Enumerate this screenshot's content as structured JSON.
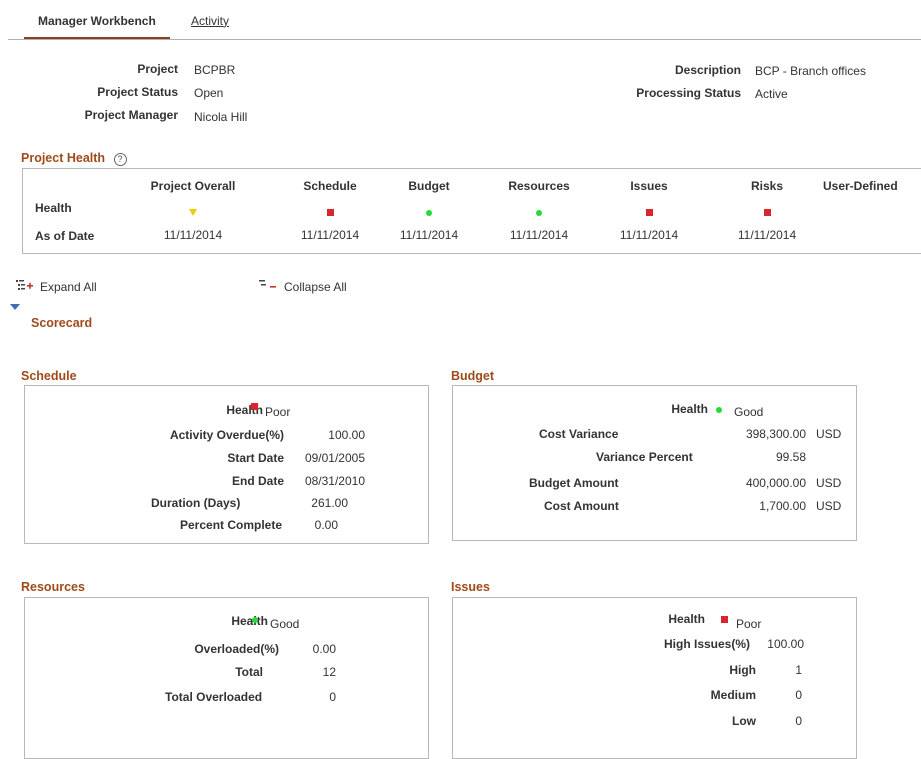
{
  "tabs": [
    {
      "label": "Manager Workbench",
      "active": true
    },
    {
      "label": "Activity",
      "active": false
    }
  ],
  "header": {
    "project_label": "Project",
    "project_value": "BCPBR",
    "status_label": "Project Status",
    "status_value": "Open",
    "manager_label": "Project Manager",
    "manager_value": "Nicola Hill",
    "description_label": "Description",
    "description_value": "BCP - Branch offices",
    "processing_label": "Processing Status",
    "processing_value": "Active"
  },
  "project_health": {
    "title": "Project Health",
    "help_icon": "?",
    "row_health": "Health",
    "row_asof": "As of Date",
    "columns": [
      "Project Overall",
      "Schedule",
      "Budget",
      "Resources",
      "Issues",
      "Risks",
      "User-Defined"
    ],
    "indicators": [
      "triangle-yellow",
      "square-red",
      "circle-green",
      "circle-green",
      "square-red",
      "square-red",
      ""
    ],
    "dates": [
      "11/11/2014",
      "11/11/2014",
      "11/11/2014",
      "11/11/2014",
      "11/11/2014",
      "11/11/2014",
      ""
    ]
  },
  "toolbar": {
    "expand_label": "Expand All",
    "collapse_label": "Collapse All",
    "scorecard_label": "Scorecard"
  },
  "schedule": {
    "title": "Schedule",
    "health_label": "Health",
    "health_value": "Poor",
    "overdue_label": "Activity Overdue(%)",
    "overdue_value": "100.00",
    "start_label": "Start Date",
    "start_value": "09/01/2005",
    "end_label": "End Date",
    "end_value": "08/31/2010",
    "duration_label": "Duration (Days)",
    "duration_value": "261.00",
    "complete_label": "Percent Complete",
    "complete_value": "0.00"
  },
  "budget": {
    "title": "Budget",
    "health_label": "Health",
    "health_value": "Good",
    "cost_var_label": "Cost Variance",
    "cost_var_value": "398,300.00",
    "cost_var_cur": "USD",
    "var_pct_label": "Variance Percent",
    "var_pct_value": "99.58",
    "budget_amt_label": "Budget Amount",
    "budget_amt_value": "400,000.00",
    "budget_amt_cur": "USD",
    "cost_amt_label": "Cost Amount",
    "cost_amt_value": "1,700.00",
    "cost_amt_cur": "USD"
  },
  "resources": {
    "title": "Resources",
    "health_label": "Health",
    "health_value": "Good",
    "overloaded_pct_label": "Overloaded(%)",
    "overloaded_pct_value": "0.00",
    "total_label": "Total",
    "total_value": "12",
    "total_overloaded_label": "Total Overloaded",
    "total_overloaded_value": "0"
  },
  "issues": {
    "title": "Issues",
    "health_label": "Health",
    "health_value": "Poor",
    "high_pct_label": "High Issues(%)",
    "high_pct_value": "100.00",
    "high_label": "High",
    "high_value": "1",
    "medium_label": "Medium",
    "medium_value": "0",
    "low_label": "Low",
    "low_value": "0"
  }
}
